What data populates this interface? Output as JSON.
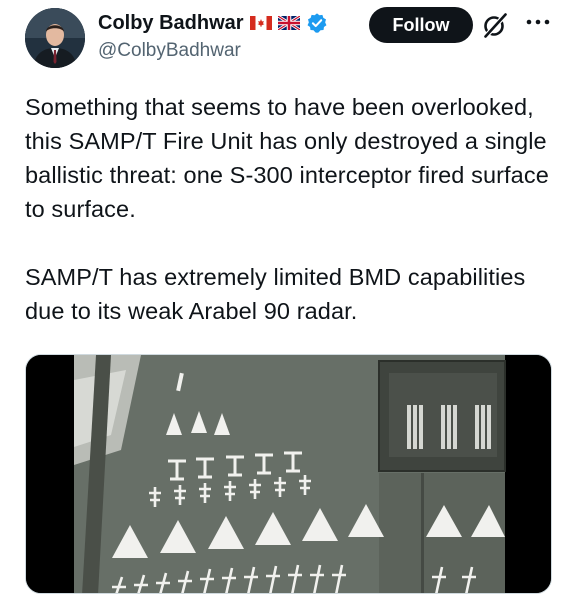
{
  "author": {
    "display_name": "Colby Badhwar",
    "handle": "@ColbyBadhwar",
    "flags": [
      "canada-flag",
      "uk-flag"
    ],
    "verified": true
  },
  "actions": {
    "follow_label": "Follow"
  },
  "tweet": {
    "paragraphs": [
      "Something that seems to have been overlooked, this SAMP/T Fire Unit has only destroyed a single ballistic threat: one S-300 interceptor fired surface to surface.",
      "SAMP/T has extremely limited BMD capabilities due to its weak Arabel 90 radar."
    ]
  },
  "media": {
    "type": "video",
    "icons": [
      "missile-kill-marker",
      "aircraft-kill-marker",
      "drone-kill-marker"
    ]
  },
  "colors": {
    "text": "#0f1419",
    "secondary": "#536471",
    "verified": "#1d9bf0",
    "follow_bg": "#0f1419"
  }
}
